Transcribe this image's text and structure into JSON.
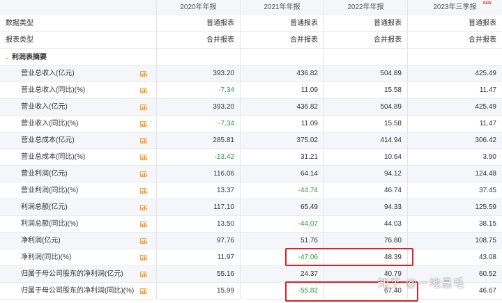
{
  "header": {
    "columns": [
      "2020年年报",
      "2021年年报",
      "2022年年报",
      "2023年三季报"
    ],
    "new_badge": "NEW"
  },
  "meta_rows": [
    {
      "label": "数据类型",
      "values": [
        "普通报表",
        "普通报表",
        "普通报表",
        "普通报表"
      ]
    },
    {
      "label": "报表类型",
      "values": [
        "合并报表",
        "合并报表",
        "合并报表",
        "合并报表"
      ]
    }
  ],
  "section": {
    "title": "利润表摘要"
  },
  "rows": [
    {
      "label": "营业总收入(亿元)",
      "values": [
        "393.20",
        "436.82",
        "504.89",
        "425.49"
      ]
    },
    {
      "label": "营业总收入(同比)(%)",
      "values": [
        "-7.34",
        "11.09",
        "15.58",
        "11.47"
      ]
    },
    {
      "label": "营业收入(亿元)",
      "values": [
        "393.20",
        "436.82",
        "504.89",
        "425.49"
      ]
    },
    {
      "label": "营业收入(同比)(%)",
      "values": [
        "-7.34",
        "11.09",
        "15.58",
        "11.47"
      ]
    },
    {
      "label": "营业总成本(亿元)",
      "values": [
        "285.81",
        "375.02",
        "414.94",
        "306.42"
      ]
    },
    {
      "label": "营业总成本(同比)(%)",
      "values": [
        "-13.42",
        "31.21",
        "10.64",
        "3.90"
      ]
    },
    {
      "label": "营业利润(亿元)",
      "values": [
        "116.06",
        "64.14",
        "94.12",
        "124.48"
      ]
    },
    {
      "label": "营业利润(同比)(%)",
      "values": [
        "13.37",
        "-44.74",
        "46.74",
        "37.45"
      ]
    },
    {
      "label": "利润总额(亿元)",
      "values": [
        "117.10",
        "65.49",
        "94.33",
        "125.59"
      ]
    },
    {
      "label": "利润总额(同比)(%)",
      "values": [
        "13.50",
        "-44.07",
        "44.03",
        "38.15"
      ]
    },
    {
      "label": "净利润(亿元)",
      "values": [
        "97.76",
        "51.76",
        "76.80",
        "108.75"
      ]
    },
    {
      "label": "净利润(同比)(%)",
      "values": [
        "11.97",
        "-47.06",
        "48.39",
        "43.08"
      ]
    },
    {
      "label": "归属于母公司股东的净利润(亿元)",
      "values": [
        "55.16",
        "24.37",
        "40.79",
        "60.52"
      ]
    },
    {
      "label": "归属于母公司股东的净利润(同比)(%)",
      "values": [
        "15.99",
        "-55.82",
        "67.40",
        "46.67"
      ]
    }
  ],
  "colors": {
    "negative": "#2a9d3a",
    "highlight": "#e02020",
    "icon": "#f29a2e",
    "row_alt": "#f4f6fa"
  },
  "watermark": "知乎 @一地悬毛"
}
